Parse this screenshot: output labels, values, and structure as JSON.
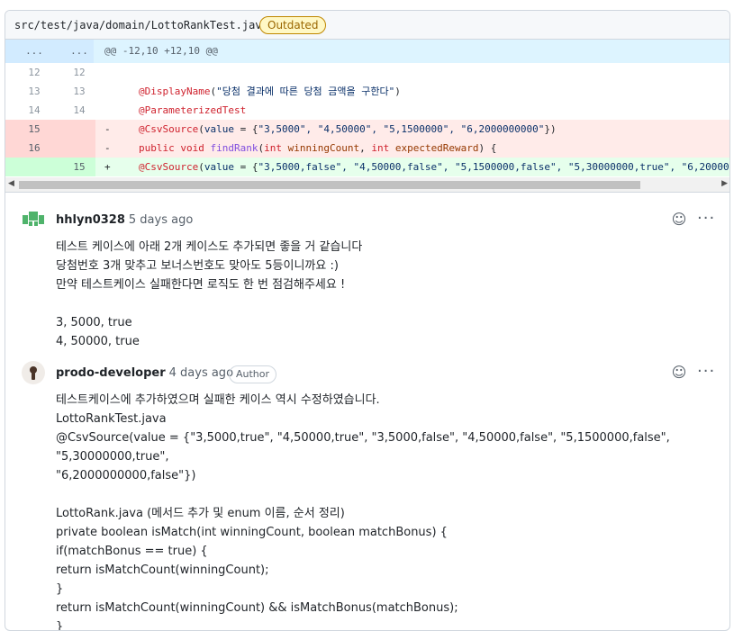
{
  "file": {
    "path": "src/test/java/domain/LottoRankTest.java",
    "status_badge": "Outdated"
  },
  "hunk": {
    "old_dots": "...",
    "new_dots": "...",
    "header": "@@ -12,10 +12,10 @@"
  },
  "lines": {
    "l12": {
      "old": "12",
      "new": "12"
    },
    "l13": {
      "old": "13",
      "new": "13",
      "ann": "@DisplayName",
      "open": "(",
      "str": "\"당첨 결과에 따른 당첨 금액을 구한다\"",
      "close": ")"
    },
    "l14": {
      "old": "14",
      "new": "14",
      "ann": "@ParameterizedTest"
    },
    "d15": {
      "old": "15",
      "sign": "-",
      "ann": "@CsvSource",
      "open": "(",
      "var": "value",
      "eq": " = {",
      "str": "\"3,5000\", \"4,50000\", \"5,1500000\", \"6,2000000000\"",
      "close": "})"
    },
    "d16": {
      "old": "16",
      "sign": "-",
      "kw1": "public void ",
      "fn": "findRank",
      "open": "(",
      "kw2": "int ",
      "var1": "winningCount",
      "sep": ", ",
      "kw3": "int ",
      "var2": "expectedReward",
      "close": ") {"
    },
    "a15": {
      "new": "15",
      "sign": "+",
      "ann": "@CsvSource",
      "open": "(",
      "var": "value",
      "eq": " = {",
      "str": "\"3,5000,false\", \"4,50000,false\", \"5,1500000,false\", \"5,30000000,true\", \"6,200000"
    }
  },
  "comments": [
    {
      "author": "hhlyn0328",
      "time": "5 days ago",
      "body": "테스트 케이스에 아래 2개 케이스도 추가되면 좋을 거 같습니다\n당첨번호 3개 맞추고 보너스번호도 맞아도 5등이니까요 :)\n만약 테스트케이스 실패한다면 로직도 한 번 점검해주세요 !\n\n3, 5000, true\n4, 50000, true",
      "avatar_color": "#4fb36b"
    },
    {
      "author": "prodo-developer",
      "time": "4 days ago",
      "role": "Author",
      "body": "테스트케이스에 추가하였으며 실패한 케이스 역시 수정하였습니다.\nLottoRankTest.java\n@CsvSource(value = {\"3,5000,true\", \"4,50000,true\", \"3,5000,false\", \"4,50000,false\", \"5,1500000,false\", \"5,30000000,true\",\n\"6,2000000000,false\"})\n\nLottoRank.java (메서드 추가 및 enum 이름, 순서 정리)\nprivate boolean isMatch(int winningCount, boolean matchBonus) {\nif(matchBonus == true) {\nreturn isMatchCount(winningCount);\n}\nreturn isMatchCount(winningCount) && isMatchBonus(matchBonus);\n}",
      "avatar_color": "#6e4a3a"
    }
  ],
  "icons": {
    "reaction": "smiley-icon",
    "more": "kebab-horizontal-icon"
  },
  "ui": {
    "more_glyph": "···",
    "scroll_left": "◀",
    "scroll_right": "▶"
  }
}
